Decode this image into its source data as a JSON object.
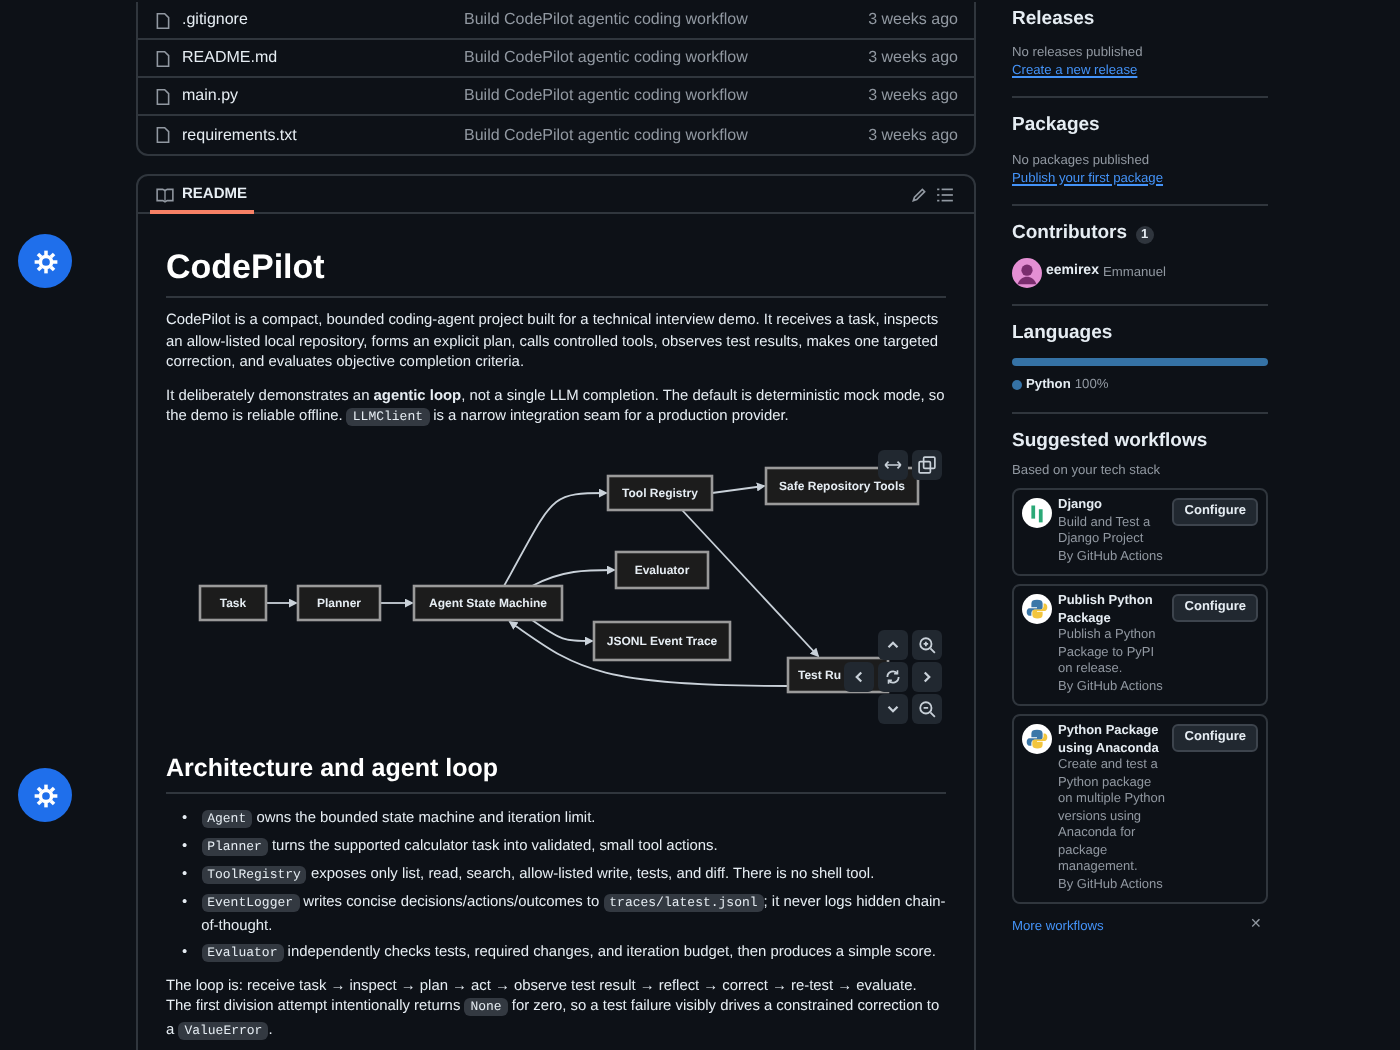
{
  "floating_buttons": [
    {
      "kind": "gear"
    },
    {
      "kind": "gear"
    }
  ],
  "files": [
    {
      "name": ".gitignore",
      "commit": "Build CodePilot agentic coding workflow",
      "time": "3 weeks ago"
    },
    {
      "name": "README.md",
      "commit": "Build CodePilot agentic coding workflow",
      "time": "3 weeks ago"
    },
    {
      "name": "main.py",
      "commit": "Build CodePilot agentic coding workflow",
      "time": "3 weeks ago"
    },
    {
      "name": "requirements.txt",
      "commit": "Build CodePilot agentic coding workflow",
      "time": "3 weeks ago"
    }
  ],
  "readme": {
    "tab": {
      "label": "README",
      "selected": true
    },
    "title": "CodePilot",
    "intro": [
      [
        {
          "kind": "text",
          "text": "CodePilot is a compact, bounded coding-agent project built for a technical interview demo. It receives a task, inspects an allow-listed local repository, forms an explicit plan, calls controlled tools, observes test results, makes one targeted correction, and evaluates objective completion criteria."
        }
      ],
      [
        {
          "kind": "text",
          "text": "It deliberately demonstrates an "
        },
        {
          "kind": "bold",
          "text": "agentic loop"
        },
        {
          "kind": "text",
          "text": ", not a single LLM completion. The default is deterministic mock mode, so the demo is reliable offline. "
        },
        {
          "kind": "code",
          "text": "LLMClient"
        },
        {
          "kind": "text",
          "text": " is a narrow integration seam for a production provider."
        }
      ]
    ],
    "diagram": {
      "nodes": [
        "Task",
        "Planner",
        "Agent State Machine",
        "Tool Registry",
        "Safe Repository Tools",
        "Evaluator",
        "JSONL Event Trace",
        "Test Ru"
      ]
    },
    "section_title": "Architecture and agent loop",
    "bullet_marker": "•",
    "bullets": [
      [
        {
          "kind": "code",
          "text": "Agent"
        },
        {
          "kind": "text",
          "text": " owns the bounded state machine and iteration limit."
        }
      ],
      [
        {
          "kind": "code",
          "text": "Planner"
        },
        {
          "kind": "text",
          "text": " turns the supported calculator task into validated, small tool actions."
        }
      ],
      [
        {
          "kind": "code",
          "text": "ToolRegistry"
        },
        {
          "kind": "text",
          "text": " exposes only list, read, search, allow-listed write, tests, and diff. There is no shell tool."
        }
      ],
      [
        {
          "kind": "code",
          "text": "EventLogger"
        },
        {
          "kind": "text",
          "text": " writes concise decisions/actions/outcomes to "
        },
        {
          "kind": "code",
          "text": "traces/latest.jsonl"
        },
        {
          "kind": "text",
          "text": "; it never logs hidden chain-of-thought."
        }
      ],
      [
        {
          "kind": "code",
          "text": "Evaluator"
        },
        {
          "kind": "text",
          "text": " independently checks tests, required changes, and iteration budget, then produces a simple score."
        }
      ]
    ],
    "loop_paragraph": [
      {
        "kind": "text",
        "text": "The loop is: receive task → inspect → plan → act → observe test result → reflect → correct → re-test → evaluate. The first division attempt intentionally returns "
      },
      {
        "kind": "code",
        "text": "None"
      },
      {
        "kind": "text",
        "text": " for zero, so a test failure visibly drives a constrained correction to a "
      },
      {
        "kind": "code",
        "text": "ValueError"
      },
      {
        "kind": "text",
        "text": "."
      }
    ]
  },
  "sidebar": {
    "releases": {
      "title": "Releases",
      "note": "No releases published",
      "link": "Create a new release"
    },
    "packages": {
      "title": "Packages",
      "note": "No packages published",
      "link": "Publish your first package"
    },
    "contributors": {
      "title": "Contributors",
      "count": "1",
      "people": [
        {
          "login": "eemirex",
          "name": "Emmanuel"
        }
      ]
    },
    "languages": {
      "title": "Languages",
      "items": [
        {
          "name": "Python",
          "percent": "100%",
          "level": 1.0,
          "color": "#3572a5"
        }
      ]
    },
    "workflows": {
      "title": "Suggested workflows",
      "subtitle": "Based on your tech stack",
      "items": [
        {
          "kind": "django",
          "name": "Django",
          "description": "Build and Test a Django Project",
          "author": "By GitHub Actions",
          "button": "Configure"
        },
        {
          "kind": "python",
          "name": "Publish Python Package",
          "description": "Publish a Python Package to PyPI on release.",
          "author": "By GitHub Actions",
          "button": "Configure"
        },
        {
          "kind": "python",
          "name": "Python Package using Anaconda",
          "description": "Create and test a Python package on multiple Python versions using Anaconda for package management.",
          "author": "By GitHub Actions",
          "button": "Configure"
        }
      ],
      "more": "More workflows",
      "dismiss": "✕"
    }
  }
}
